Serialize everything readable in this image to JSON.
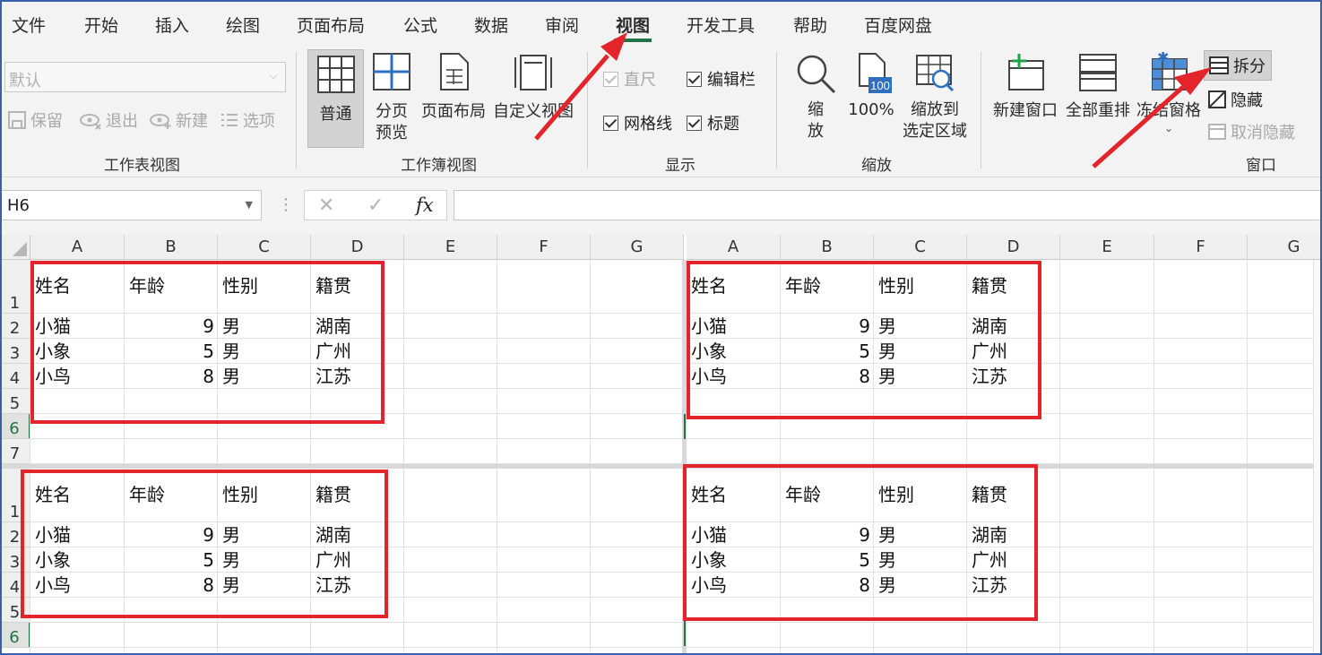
{
  "tabs": [
    "文件",
    "开始",
    "插入",
    "绘图",
    "页面布局",
    "公式",
    "数据",
    "审阅",
    "视图",
    "开发工具",
    "帮助",
    "百度网盘"
  ],
  "active_tab": "视图",
  "sheet_view_group": {
    "select_value": "默认",
    "keep": "保留",
    "exit": "退出",
    "new": "新建",
    "options": "选项",
    "label": "工作表视图"
  },
  "workbook_view_group": {
    "normal": "普通",
    "page_break_1": "分页",
    "page_break_2": "预览",
    "page_layout": "页面布局",
    "custom_views": "自定义视图",
    "label": "工作簿视图"
  },
  "show_group": {
    "ruler": "直尺",
    "formula_bar": "编辑栏",
    "gridlines": "网格线",
    "headings": "标题",
    "label": "显示"
  },
  "zoom_group": {
    "zoom_1": "缩",
    "zoom_2": "放",
    "hundred": "100%",
    "hundred_icon": "100",
    "zoom_sel_1": "缩放到",
    "zoom_sel_2": "选定区域",
    "label": "缩放"
  },
  "window_group": {
    "new_window": "新建窗口",
    "arrange_all": "全部重排",
    "freeze": "冻结窗格",
    "split": "拆分",
    "hide": "隐藏",
    "unhide": "取消隐藏",
    "label": "窗口"
  },
  "formula_bar": {
    "name_box": "H6",
    "fx": "fx",
    "cancel": "✕",
    "enter": "✓",
    "formula": ""
  },
  "columns": [
    "A",
    "B",
    "C",
    "D",
    "E",
    "F",
    "G"
  ],
  "table": {
    "headers": [
      "姓名",
      "年龄",
      "性别",
      "籍贯"
    ],
    "rows": [
      [
        "小猫",
        "9",
        "男",
        "湖南"
      ],
      [
        "小象",
        "5",
        "男",
        "广州"
      ],
      [
        "小鸟",
        "8",
        "男",
        "江苏"
      ]
    ]
  },
  "top_rows": [
    "1",
    "2",
    "3",
    "4",
    "5",
    "6",
    "7"
  ],
  "bottom_rows": [
    "1",
    "2",
    "3",
    "4",
    "5",
    "6"
  ],
  "colors": {
    "accent": "#217346",
    "annotation": "#e3242b"
  }
}
